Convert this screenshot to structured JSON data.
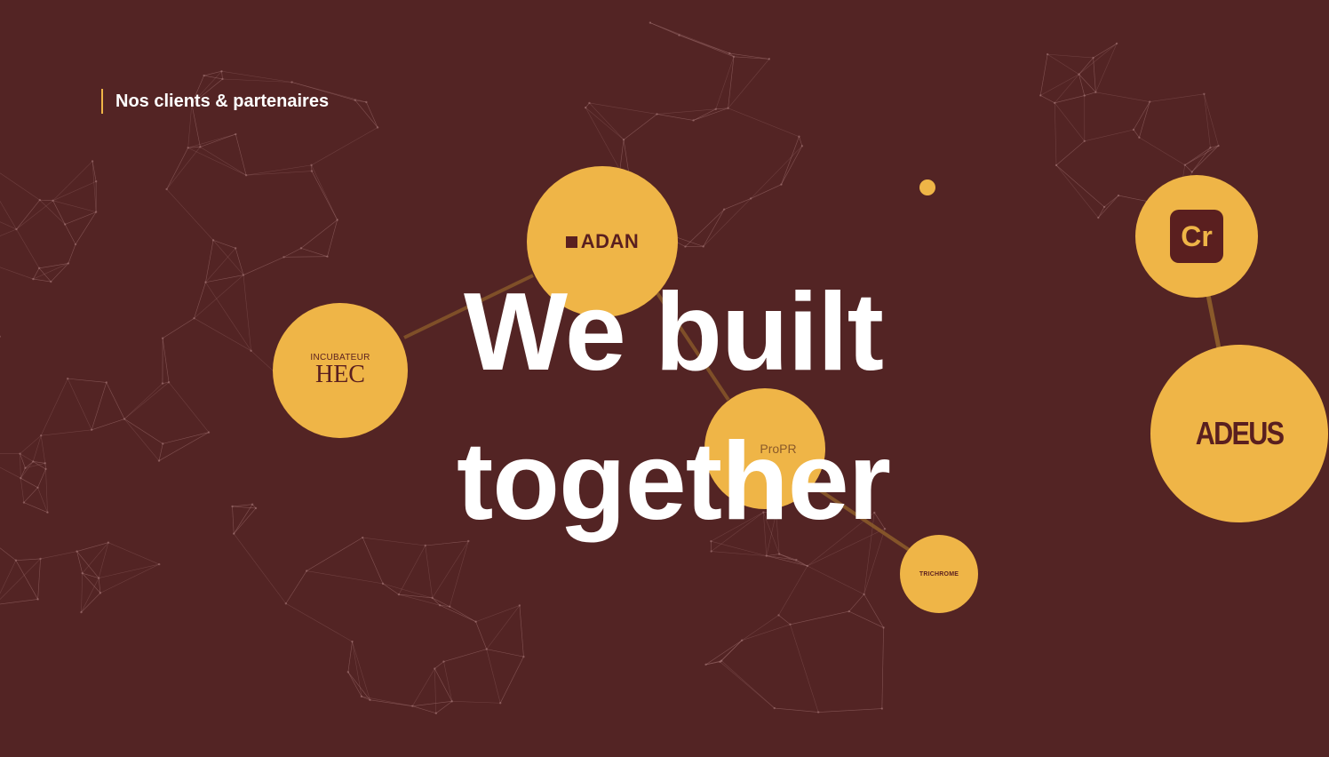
{
  "section": {
    "label": "Nos clients & partenaires"
  },
  "hero": {
    "line1": "We built",
    "line2": "together"
  },
  "partners": {
    "adan": "ADAN",
    "hec_top": "INCUBATEUR",
    "hec_bottom": "HEC",
    "propr": "ProPR",
    "trichrome": "TRICHROME",
    "cr": "Cr",
    "adeus": "ADEUS"
  },
  "colors": {
    "background": "#532424",
    "accent": "#efb547",
    "logo": "#5a1f1f",
    "text": "#ffffff"
  }
}
